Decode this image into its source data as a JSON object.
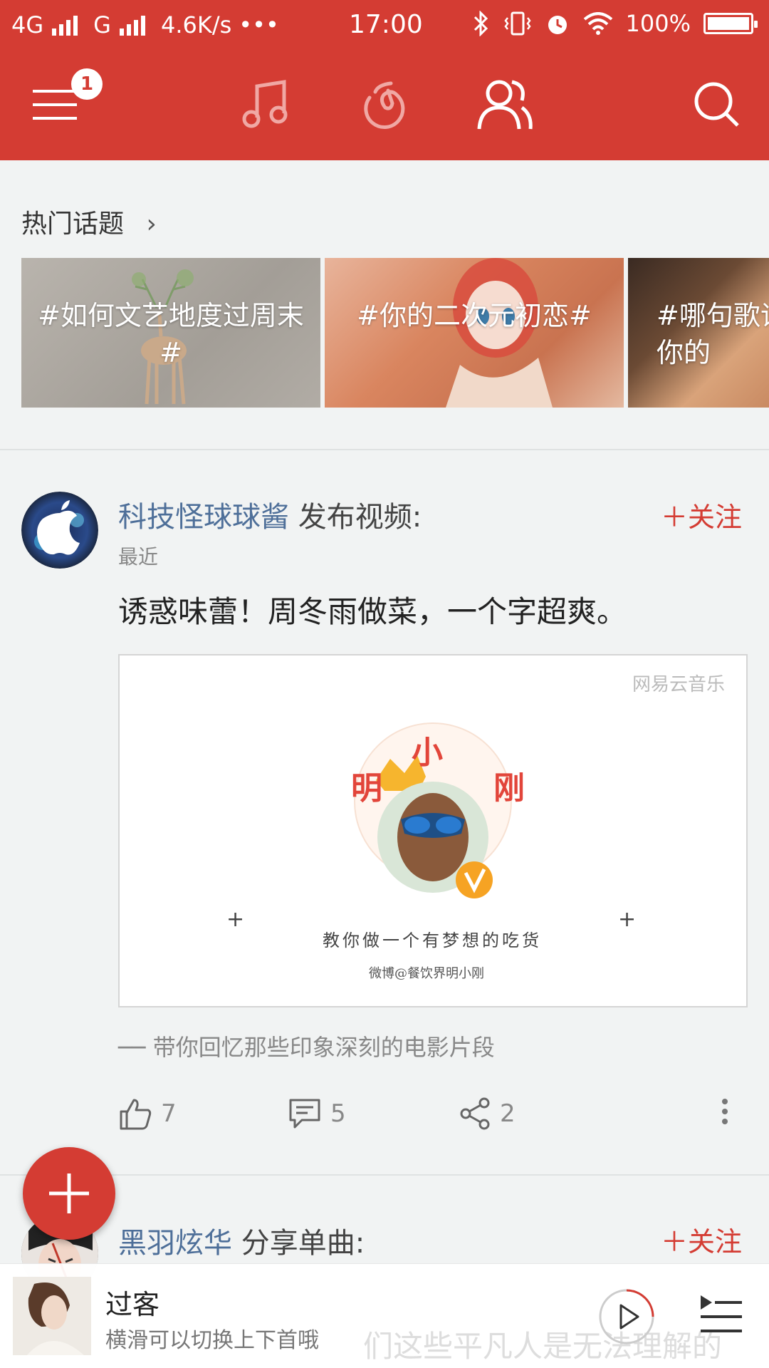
{
  "status_bar": {
    "network1": "4G",
    "network2": "G",
    "speed": "4.6K/s",
    "dots": "•••",
    "time": "17:00",
    "battery": "100%"
  },
  "toolbar": {
    "menu_badge": "1",
    "icons": [
      "menu-icon",
      "music-icon",
      "radio-icon",
      "friends-icon",
      "search-icon"
    ]
  },
  "hot_topics": {
    "title": "热门话题",
    "cards": [
      {
        "text": "#如何文艺地度过周末#"
      },
      {
        "text": "#你的二次元初恋#"
      },
      {
        "text": "#哪句歌词代表你的"
      }
    ]
  },
  "feed": [
    {
      "username": "科技怪球球酱",
      "action": " 发布视频:",
      "time": "最近",
      "follow": "关注",
      "text": "诱惑味蕾！周冬雨做菜，一个字超爽。",
      "video": {
        "watermark": "网易云音乐",
        "caption_chars": [
          "小",
          "明",
          "刚"
        ],
        "slogan": "教你做一个有梦想的吃货",
        "signature": "微博@餐饮界明小刚"
      },
      "quote": "── 带你回忆那些印象深刻的电影片段",
      "likes": "7",
      "comments": "5",
      "shares": "2"
    },
    {
      "username": "黑羽炫华",
      "action": " 分享单曲:",
      "follow": "关注"
    }
  ],
  "player": {
    "title": "过客",
    "subtitle": "横滑可以切换上下首哦",
    "ghost_text": "们这些平凡人是无法理解的"
  },
  "colors": {
    "brand": "#d43c33",
    "link": "#4e6f99"
  }
}
